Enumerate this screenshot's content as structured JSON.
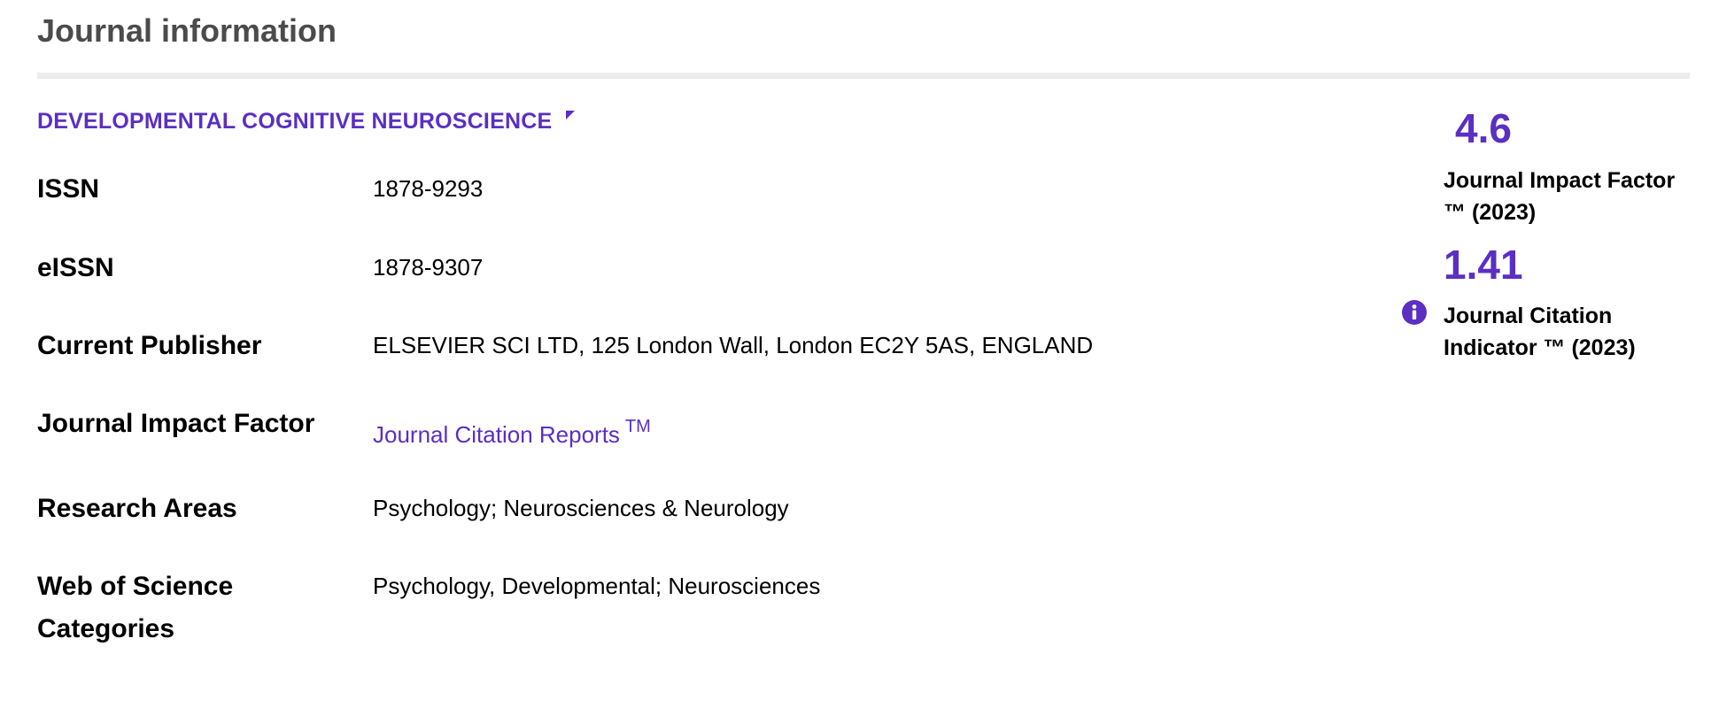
{
  "section": {
    "title": "Journal information"
  },
  "journal": {
    "name": "DEVELOPMENTAL COGNITIVE NEUROSCIENCE"
  },
  "fields": {
    "issn": {
      "label": "ISSN",
      "value": "1878-9293"
    },
    "eissn": {
      "label": "eISSN",
      "value": "1878-9307"
    },
    "publisher": {
      "label": "Current Publisher",
      "value": "ELSEVIER SCI LTD, 125 London Wall, London EC2Y 5AS, ENGLAND"
    },
    "impact_factor": {
      "label": "Journal Impact Factor",
      "link_text": "Journal Citation Reports",
      "link_sup": "TM"
    },
    "research_areas": {
      "label": "Research Areas",
      "value": "Psychology; Neurosciences & Neurology"
    },
    "wos_categories": {
      "label_line1": "Web of Science",
      "label_line2": "Categories",
      "value": "Psychology, Developmental; Neurosciences"
    }
  },
  "metrics": {
    "jif": {
      "value": "4.6",
      "label_line1": "Journal Impact Factor",
      "label_line2": "™ (2023)"
    },
    "jci": {
      "value": "1.41",
      "label_line1": "Journal Citation",
      "label_line2": "Indicator ™ (2023)",
      "icon": "info-icon"
    }
  },
  "colors": {
    "accent": "#5a2fc2",
    "divider": "#ececec",
    "title": "#4b4b4b"
  }
}
